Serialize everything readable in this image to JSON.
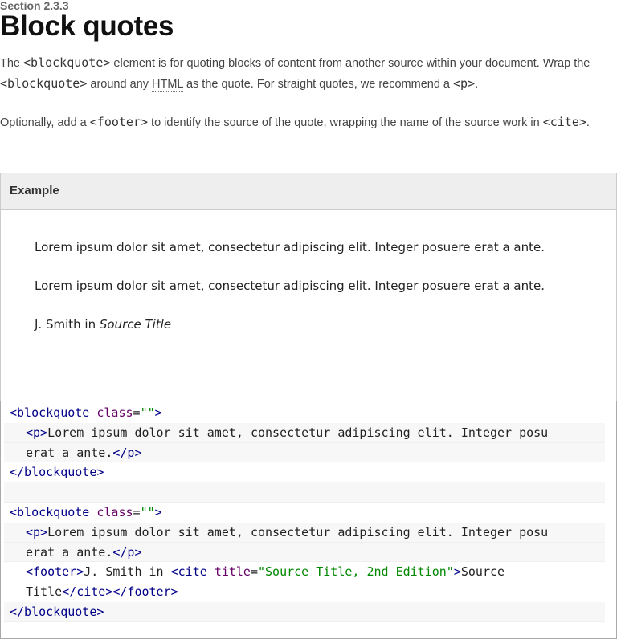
{
  "section_label": "Section 2.3.3",
  "title": "Block quotes",
  "intro": {
    "p1": {
      "t1": "The ",
      "c1": "<blockquote>",
      "t2": " element is for quoting blocks of content from another source within your document. Wrap the ",
      "c2": "<blockquote>",
      "t3": " around any ",
      "abbr": "HTML",
      "t4": " as the quote. For straight quotes, we recommend a ",
      "c3": "<p>",
      "t5": "."
    },
    "p2": {
      "t1": "Optionally, add a ",
      "c1": "<footer>",
      "t2": " to identify the source of the quote, wrapping the name of the source work in ",
      "c2": "<cite>",
      "t3": "."
    }
  },
  "example": {
    "header": "Example",
    "quote1": "Lorem ipsum dolor sit amet, consectetur adipiscing elit. Integer posuere erat a ante.",
    "quote2": "Lorem ipsum dolor sit amet, consectetur adipiscing elit. Integer posuere erat a ante.",
    "footer_prefix": "J. Smith in ",
    "footer_cite": "Source Title"
  },
  "code": {
    "bq_open": "<blockquote",
    "attr_class": "class",
    "eq": "=",
    "empty_str": "\"\"",
    "gt": ">",
    "p_open": "<p>",
    "lorem_a": "Lorem ipsum dolor sit amet, consectetur adipiscing elit. Integer posu",
    "lorem_b": "erat a ante.",
    "p_close": "</p>",
    "bq_close": "</blockquote>",
    "footer_open": "<footer>",
    "author": "J. Smith in ",
    "cite_open": "<cite",
    "attr_title": "title",
    "title_val": "\"Source Title, 2nd Edition\"",
    "cite_text_a": "Source",
    "cite_text_b": "Title",
    "cite_close": "</cite>",
    "footer_close": "</footer>"
  }
}
